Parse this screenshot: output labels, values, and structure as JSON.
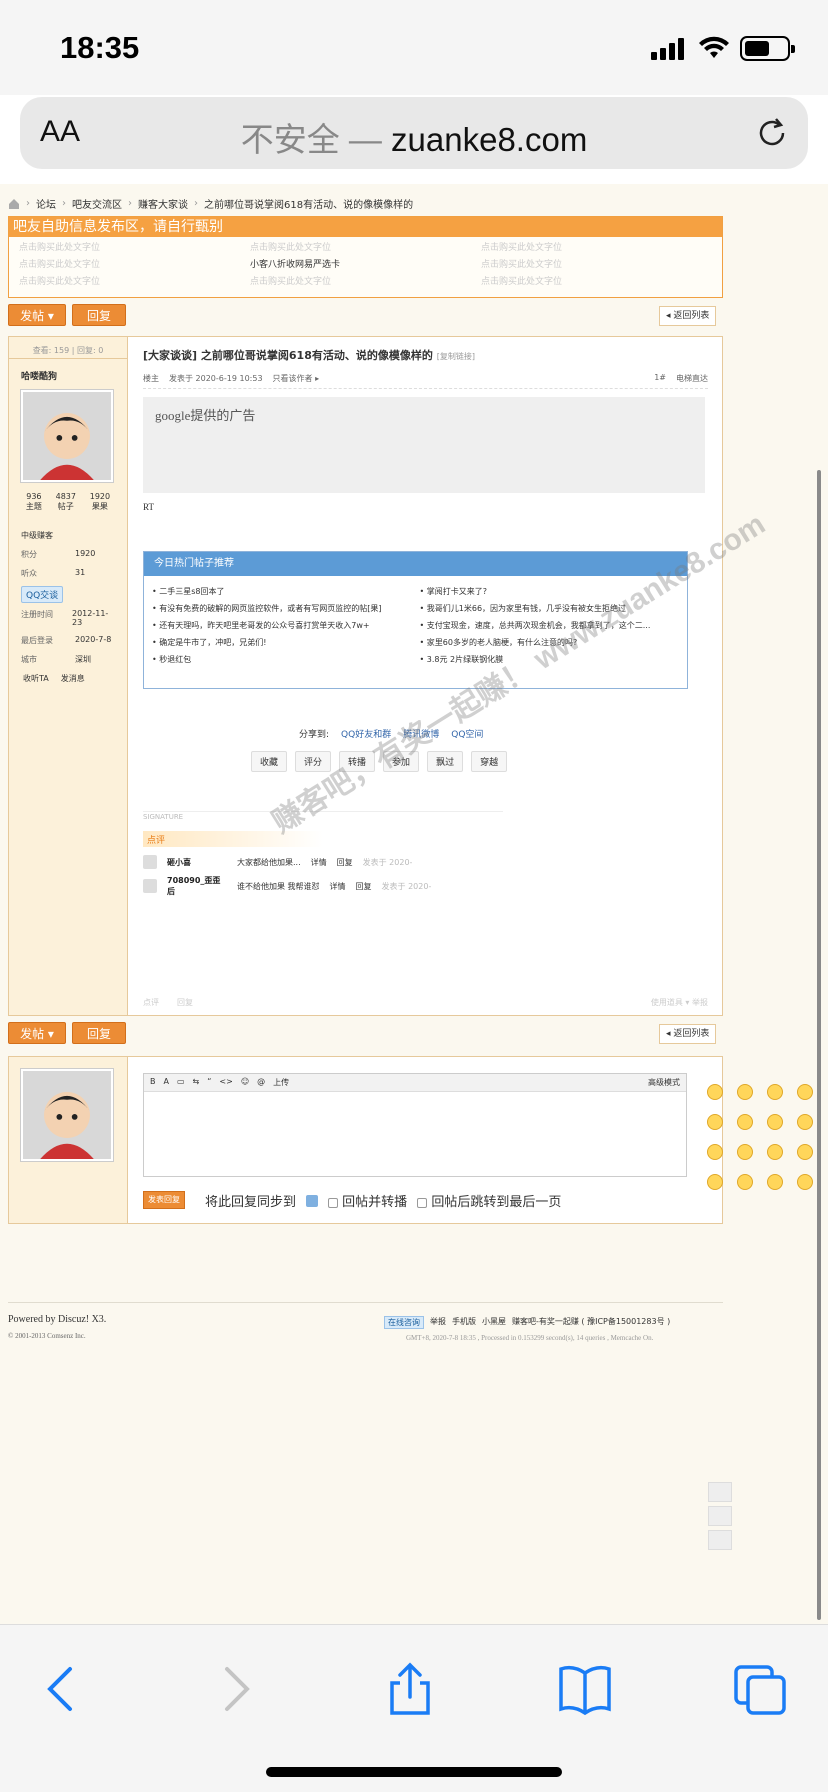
{
  "status": {
    "time": "18:35"
  },
  "address": {
    "aa": "AA",
    "insecure": "不安全 —",
    "host": "zuanke8.com"
  },
  "breadcrumb": [
    "论坛",
    "吧友交流区",
    "赚客大家谈",
    "之前哪位哥说掌阅618有活动、说的像模像样的"
  ],
  "ad_area": {
    "title": "吧友自助信息发布区，请自行甄别",
    "items": [
      "点击购买此处文字位",
      "点击购买此处文字位",
      "点击购买此处文字位",
      "点击购买此处文字位",
      "小客八折收网易严选卡",
      "点击购买此处文字位",
      "点击购买此处文字位",
      "点击购买此处文字位",
      "点击购买此处文字位"
    ]
  },
  "buttons": {
    "post": "发帖 ▾",
    "reply": "回复",
    "back_list": "◂ 返回列表"
  },
  "post": {
    "views": "查看: 159",
    "replies": "回复: 0",
    "username": "哈喽酷狗",
    "stats": [
      {
        "value": "936",
        "label": "主题"
      },
      {
        "value": "4837",
        "label": "帖子"
      },
      {
        "value": "1920",
        "label": "果果"
      }
    ],
    "rank": "中级赚客",
    "info": [
      {
        "k": "积分",
        "v": "1920"
      },
      {
        "k": "听众",
        "v": "31"
      }
    ],
    "qq": "QQ交谈",
    "info2": [
      {
        "k": "注册时间",
        "v": "2012-11-23"
      },
      {
        "k": "最后登录",
        "v": "2020-7-8"
      },
      {
        "k": "城市",
        "v": "深圳"
      }
    ],
    "listen": "收听TA",
    "message": "发消息",
    "title": "[大家谈谈] 之前哪位哥说掌阅618有活动、说的像模像样的",
    "copy_link": "[复制链接]",
    "author_tag": "楼主",
    "posted": "发表于 2020-6-19 10:53",
    "only_author": "只看该作者 ▸",
    "floor": "1#",
    "elevator": "电梯直达",
    "google_ad": "google提供的广告",
    "body": "RT",
    "hot_title": "今日热门帖子推荐",
    "hot_left": [
      "二手三星s8回本了",
      "有没有免费的破解的网页监控软件，或者有写网页监控的帖[果]",
      "还有天理吗，昨天吧里老哥发的公众号喜打赏单天收入7w+",
      "确定是牛市了，冲吧，兄弟们!",
      "秒退红包"
    ],
    "hot_right": [
      "掌阅打卡又来了?",
      "我哥们儿1米66，因为家里有钱，几乎没有被女生拒绝过",
      "支付宝现金，速度，总共两次现金机会，我都拿到了，这个二...",
      "家里60多岁的老人脑梗，有什么注意的吗?",
      "3.8元 2片绿联钢化膜"
    ],
    "share_label": "分享到:",
    "share": [
      "QQ好友和群",
      "腾讯微博",
      "QQ空间"
    ],
    "actions": [
      "收藏",
      "评分",
      "转播",
      "参加",
      "飘过",
      "穿越"
    ],
    "signature": "SIGNATURE",
    "comment_title": "点评",
    "comments": [
      {
        "user": "砸小喜",
        "text": "大家都给他加果...",
        "detail": "详情",
        "reply": "回复",
        "time": "发表于 2020-"
      },
      {
        "user": "708090_歪歪后",
        "text": "谁不给他加果 我帮谁怼",
        "detail": "详情",
        "reply": "回复",
        "time": "发表于 2020-"
      }
    ],
    "watermark": "赚客吧，有奖一起赚！ www.zuanke8.com",
    "foot_left": [
      "点评",
      "回复"
    ],
    "foot_right": "使用道具 ▾  举报"
  },
  "reply_box": {
    "toolbar": [
      "B",
      "A",
      "▭",
      "⇆",
      "“",
      "<>",
      "☺",
      "@",
      "上传"
    ],
    "advanced": "高级模式",
    "submit": "发表回复",
    "sync": "将此回复同步到",
    "opt1": "回帖并转播",
    "opt2": "回帖后跳转到最后一页"
  },
  "footer": {
    "powered": "Powered by Discuz! X3.",
    "copyright": "© 2001-2013 Comsenz Inc.",
    "links": [
      "在线咨询",
      "举报",
      "手机版",
      "小黑屋",
      "赚客吧-有奖一起赚 ( 豫ICP备15001283号 )"
    ],
    "gmt": "GMT+8, 2020-7-8 18:35 , Processed in 0.153299 second(s), 14 queries , Memcache On."
  }
}
